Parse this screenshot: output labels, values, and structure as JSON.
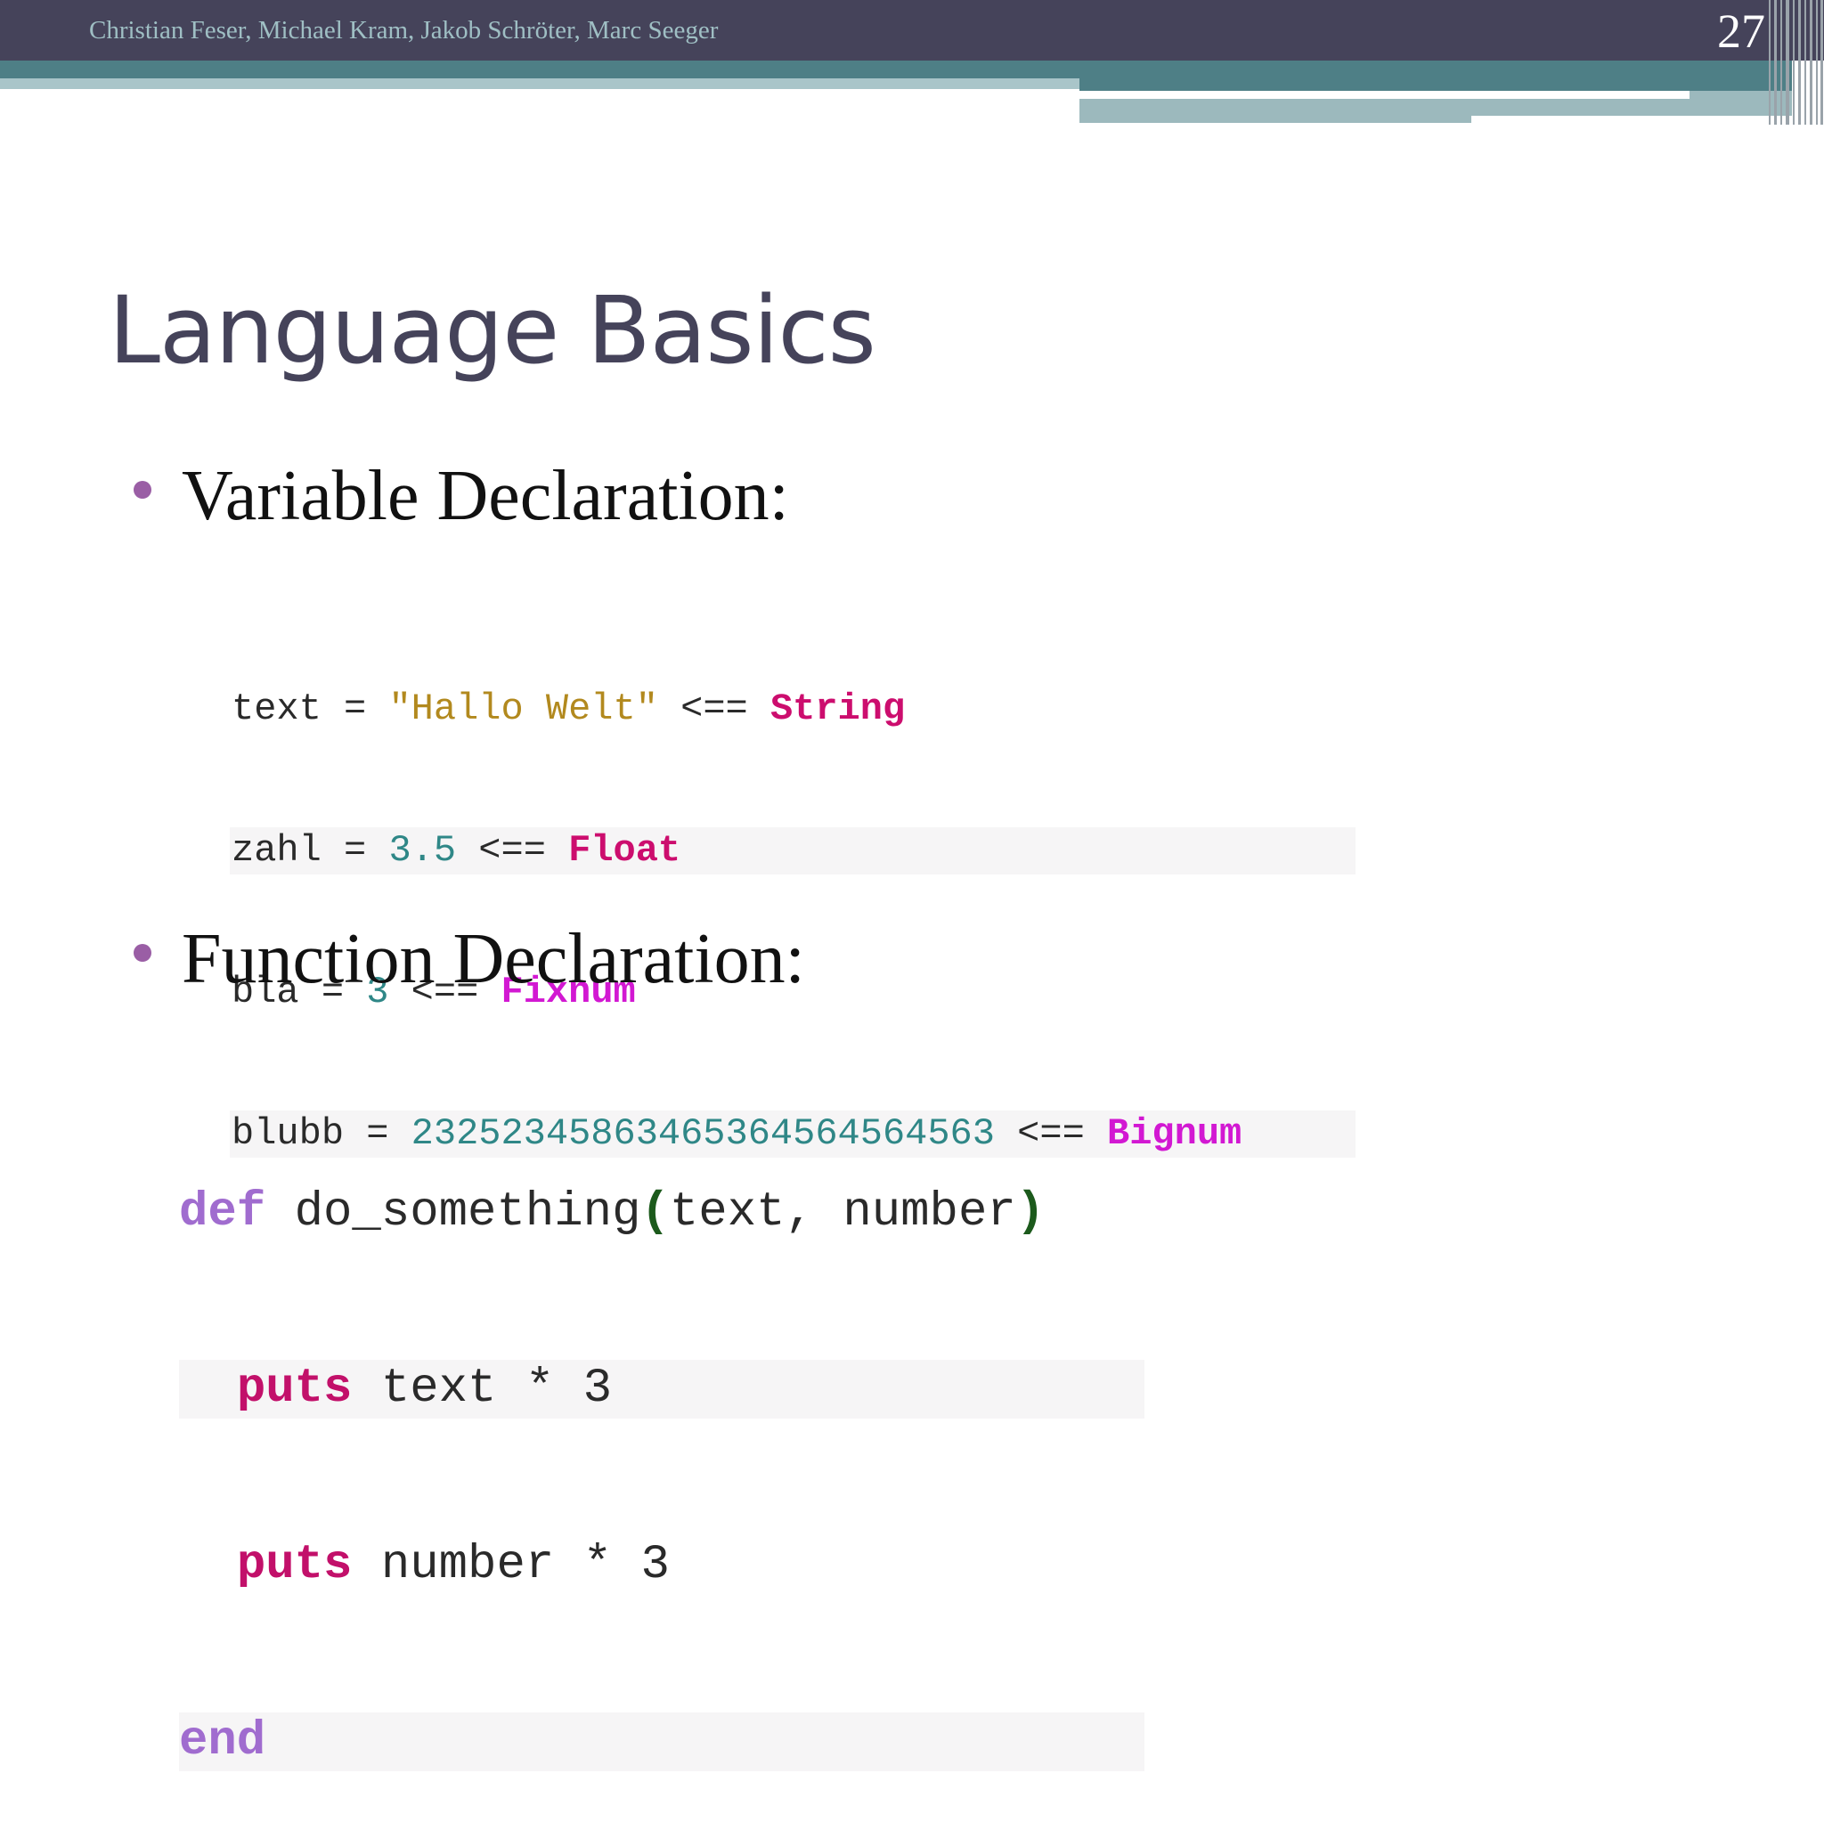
{
  "header": {
    "authors": "Christian Feser, Michael Kram, Jakob Schröter, Marc Seeger",
    "page_number": "27"
  },
  "slide": {
    "title": "Language Basics",
    "bullets": [
      {
        "label": "Variable Declaration:"
      },
      {
        "label": "Function Declaration:"
      }
    ]
  },
  "variable_code": {
    "line1": {
      "var": "text",
      "eq": " = ",
      "value": "\"Hallo Welt\"",
      "arrow": " <== ",
      "type": "String"
    },
    "line2": {
      "var": "zahl",
      "eq": " = ",
      "value": "3.5",
      "arrow": " <== ",
      "type": "Float"
    },
    "line3": {
      "var": "bla",
      "eq": " = ",
      "value": "3",
      "arrow": " <== ",
      "type": "Fixnum"
    },
    "line4": {
      "var": "blubb",
      "eq": " = ",
      "value": "2325234586346536456456456​3",
      "arrow": " <== ",
      "type": "Bignum"
    }
  },
  "function_code": {
    "line1": {
      "kw": "def",
      "name": " do_something",
      "open": "(",
      "params": "text, number",
      "close": ")"
    },
    "line2": {
      "indent": "  ",
      "kw": "puts",
      "rest": " text * 3"
    },
    "line3": {
      "indent": "  ",
      "kw": "puts",
      "rest": " number * 3"
    },
    "line4": {
      "kw": "end"
    }
  },
  "colors": {
    "header_bg": "#45435a",
    "accent_teal": "#4e7f86",
    "bullet": "#9a5ea5",
    "title": "#45435a"
  }
}
